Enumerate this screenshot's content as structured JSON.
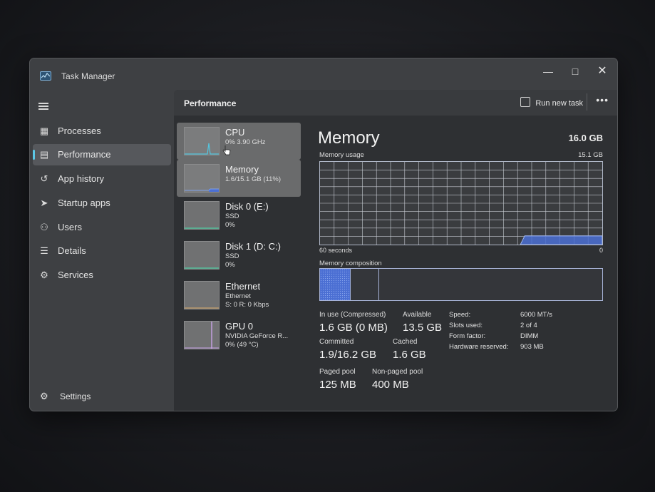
{
  "window": {
    "title": "Task Manager"
  },
  "sidebar": {
    "items": [
      {
        "label": "Processes",
        "icon": "processes-icon"
      },
      {
        "label": "Performance",
        "icon": "performance-icon",
        "active": true
      },
      {
        "label": "App history",
        "icon": "history-icon"
      },
      {
        "label": "Startup apps",
        "icon": "startup-icon"
      },
      {
        "label": "Users",
        "icon": "users-icon"
      },
      {
        "label": "Details",
        "icon": "details-icon"
      },
      {
        "label": "Services",
        "icon": "services-icon"
      }
    ],
    "settings_label": "Settings"
  },
  "header": {
    "title": "Performance",
    "run_new_task": "Run new task",
    "more": "•••"
  },
  "tiles": [
    {
      "name": "CPU",
      "sub1": "0% 3.90 GHz",
      "sub2": ""
    },
    {
      "name": "Memory",
      "sub1": "1.6/15.1 GB (11%)",
      "sub2": ""
    },
    {
      "name": "Disk 0 (E:)",
      "sub1": "SSD",
      "sub2": "0%"
    },
    {
      "name": "Disk 1 (D: C:)",
      "sub1": "SSD",
      "sub2": "0%"
    },
    {
      "name": "Ethernet",
      "sub1": "Ethernet",
      "sub2": "S: 0 R: 0 Kbps"
    },
    {
      "name": "GPU 0",
      "sub1": "NVIDIA GeForce R...",
      "sub2": "0% (49 °C)"
    }
  ],
  "memory": {
    "title": "Memory",
    "total": "16.0 GB",
    "usage_label": "Memory usage",
    "usage_max": "15.1 GB",
    "axis_left": "60 seconds",
    "axis_right": "0",
    "composition_label": "Memory composition",
    "in_use_fraction": 0.106,
    "stats": {
      "in_use_label": "In use (Compressed)",
      "in_use_value": "1.6 GB (0 MB)",
      "available_label": "Available",
      "available_value": "13.5 GB",
      "committed_label": "Committed",
      "committed_value": "1.9/16.2 GB",
      "cached_label": "Cached",
      "cached_value": "1.6 GB",
      "paged_label": "Paged pool",
      "paged_value": "125 MB",
      "nonpaged_label": "Non-paged pool",
      "nonpaged_value": "400 MB"
    },
    "specs": [
      {
        "key": "Speed:",
        "value": "6000 MT/s"
      },
      {
        "key": "Slots used:",
        "value": "2 of 4"
      },
      {
        "key": "Form factor:",
        "value": "DIMM"
      },
      {
        "key": "Hardware reserved:",
        "value": "903 MB"
      }
    ]
  },
  "colors": {
    "accent": "#5cc8e6",
    "memory_fill": "#4b6fd3",
    "cpu_line": "#53c6e0",
    "disk_line": "#4fd1a5",
    "gpu_line": "#c9a3e8"
  }
}
